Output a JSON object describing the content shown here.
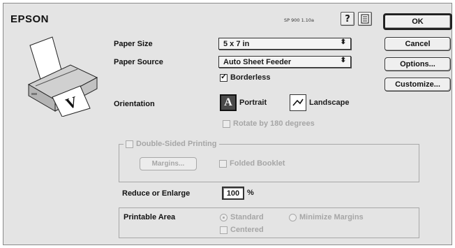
{
  "header": {
    "brand": "EPSON",
    "version": "SP 900 1.10a"
  },
  "icons": {
    "help": "question-mark-icon",
    "manual": "manual-icon"
  },
  "buttons": {
    "ok": "OK",
    "cancel": "Cancel",
    "options": "Options...",
    "customize": "Customize..."
  },
  "paper": {
    "size_label": "Paper Size",
    "size_value": "5 x 7 in",
    "source_label": "Paper Source",
    "source_value": "Auto Sheet Feeder",
    "borderless_label": "Borderless",
    "borderless_checked": true
  },
  "orientation": {
    "label": "Orientation",
    "portrait": "Portrait",
    "landscape": "Landscape",
    "selected": "Portrait",
    "rotate_label": "Rotate by 180 degrees"
  },
  "double_sided": {
    "title": "Double-Sided Printing",
    "margins_button": "Margins...",
    "folded_booklet": "Folded Booklet"
  },
  "reduce": {
    "label": "Reduce or Enlarge",
    "value": "100",
    "unit": "%"
  },
  "printable_area": {
    "label": "Printable Area",
    "standard": "Standard",
    "minimize": "Minimize Margins",
    "centered": "Centered",
    "selected": "Standard"
  },
  "colors": {
    "window_bg": "#e4e4e4",
    "disabled": "#a6a6a6"
  }
}
